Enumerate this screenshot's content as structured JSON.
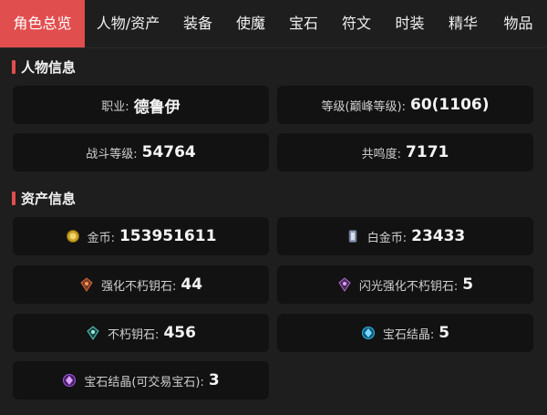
{
  "tabs": [
    {
      "label": "角色总览",
      "active": true
    },
    {
      "label": "人物/资产",
      "active": false
    },
    {
      "label": "装备",
      "active": false
    },
    {
      "label": "使魔",
      "active": false
    },
    {
      "label": "宝石",
      "active": false
    },
    {
      "label": "符文",
      "active": false
    },
    {
      "label": "时装",
      "active": false
    },
    {
      "label": "精华",
      "active": false
    },
    {
      "label": "物品",
      "active": false
    }
  ],
  "character": {
    "title": "人物信息",
    "class": {
      "label": "职业:",
      "value": "德鲁伊"
    },
    "level": {
      "label": "等级(巅峰等级):",
      "value": "60(1106)"
    },
    "combat": {
      "label": "战斗等级:",
      "value": "54764"
    },
    "resonance": {
      "label": "共鸣度:",
      "value": "7171"
    }
  },
  "assets": {
    "title": "资产信息",
    "gold": {
      "label": "金币:",
      "value": "153951611",
      "icon": "gold-coin-icon"
    },
    "platinum": {
      "label": "白金币:",
      "value": "23433",
      "icon": "platinum-coin-icon"
    },
    "reforge_stone": {
      "label": "强化不朽钥石:",
      "value": "44",
      "icon": "reforge-stone-icon"
    },
    "flawless_reforge_stone": {
      "label": "闪光强化不朽钥石:",
      "value": "5",
      "icon": "flawless-reforge-stone-icon"
    },
    "eternal_stone": {
      "label": "不朽钥石:",
      "value": "456",
      "icon": "eternal-stone-icon"
    },
    "gem_crystal": {
      "label": "宝石结晶:",
      "value": "5",
      "icon": "gem-crystal-icon"
    },
    "tradeable_gem_crystal": {
      "label": "宝石结晶(可交易宝石):",
      "value": "3",
      "icon": "tradeable-gem-crystal-icon"
    }
  },
  "colors": {
    "accent": "#e14e4e",
    "background": "#1e1e1e",
    "card": "#121212"
  }
}
